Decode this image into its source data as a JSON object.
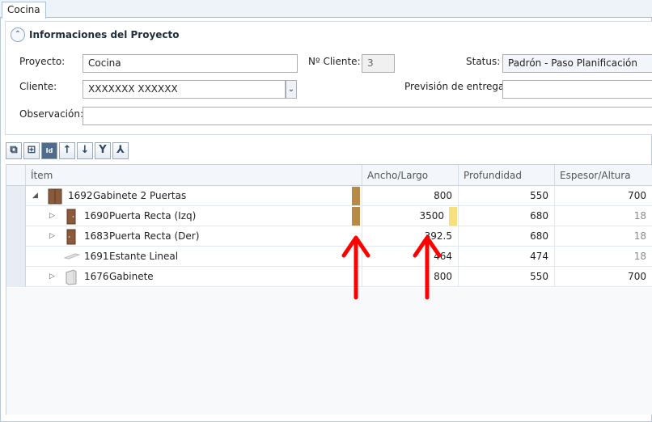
{
  "tab": {
    "label": "Cocina"
  },
  "panel": {
    "title": "Informaciones del Proyecto",
    "fields": {
      "proyecto": {
        "label": "Proyecto:",
        "value": "Cocina"
      },
      "cliente_no": {
        "label": "Nº Cliente:",
        "value": "3"
      },
      "status": {
        "label": "Status:",
        "value": "Padrón - Paso Planificación"
      },
      "cliente": {
        "label": "Cliente:",
        "value": "XXXXXXX XXXXXX"
      },
      "prevision": {
        "label": "Previsión de entrega:",
        "value": ""
      },
      "observacion": {
        "label": "Observación:",
        "value": ""
      }
    }
  },
  "toolbar": {
    "buttons": [
      "group-add-icon",
      "add-icon",
      "id-icon",
      "move-up-icon",
      "move-down-icon",
      "merge-icon",
      "split-icon"
    ],
    "id_label": "Id"
  },
  "grid": {
    "columns": [
      "Ítem",
      "Ancho/Largo",
      "Profundidad",
      "Espesor/Altura"
    ],
    "rows": [
      {
        "id": "1692",
        "name": "Gabinete 2 Puertas",
        "ancho": "800",
        "profundidad": "550",
        "espesor": "700",
        "color": "#b98a47"
      },
      {
        "id": "1690",
        "name": "Puerta Recta (Izq)",
        "ancho": "3500",
        "profundidad": "680",
        "espesor": "18",
        "color": "#b98a47",
        "highlight": "#f6df7d"
      },
      {
        "id": "1683",
        "name": "Puerta Recta (Der)",
        "ancho": "392.5",
        "profundidad": "680",
        "espesor": "18"
      },
      {
        "id": "1691",
        "name": "Estante Lineal",
        "ancho": "464",
        "profundidad": "474",
        "espesor": "18"
      },
      {
        "id": "1676",
        "name": "Gabinete",
        "ancho": "800",
        "profundidad": "550",
        "espesor": "700"
      }
    ]
  },
  "annotation_color": "#ff0000"
}
